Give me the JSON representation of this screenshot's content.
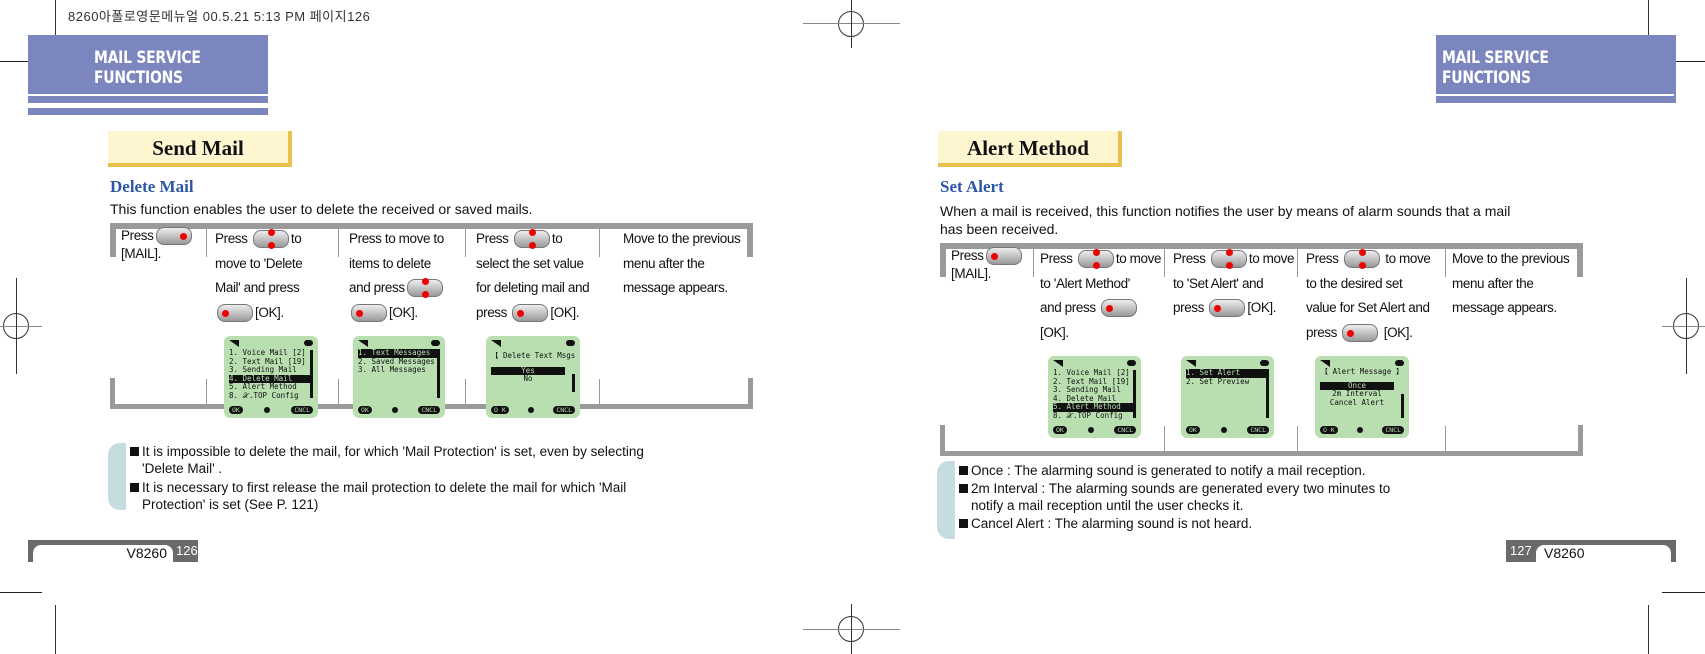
{
  "print_header": "8260아폴로영문메뉴얼   00.5.21 5:13 PM 페이지126",
  "left_page": {
    "banner": "MAIL SERVICE FUNCTIONS",
    "section_title": "Send Mail",
    "subtitle": "Delete Mail",
    "intro": "This function enables the user to delete the received or saved mails.",
    "steps": [
      {
        "pre": "Press",
        "key": "mail-key",
        "post": "[MAIL]."
      },
      {
        "pre": "Press",
        "key": "nav-key",
        "l1": "to",
        "l2": "move to  'Delete",
        "l3": "Mail'  and press",
        "l4": "[OK]."
      },
      {
        "l1": "Press to move to",
        "l2": "items to delete",
        "l3": "and press",
        "l4": "[OK]."
      },
      {
        "pre": "Press",
        "l1": "to",
        "l2": "select the set value",
        "l3": "for deleting mail and",
        "l4pre": "press",
        "l4": "[OK]."
      },
      {
        "l1": "Move to the previous",
        "l2": "menu after the",
        "l3": "message appears."
      }
    ],
    "screens": [
      {
        "rows": [
          "1. Voice Mail [2]",
          "2. Text Mail [19]",
          "3. Sending Mail",
          "4. Delete Mail",
          "5. Alert Method",
          "8. 𝒳.TOP Config"
        ],
        "selected": 3,
        "ok": "OK",
        "cancel": "CNCL"
      },
      {
        "rows": [
          "1. Text Messages",
          "2. Saved Messages",
          "3. All Messages"
        ],
        "selected": 0,
        "ok": "OK",
        "cancel": "CNCL"
      },
      {
        "title": "【 Delete Text Msgs 】",
        "rows": [
          "Yes",
          "No"
        ],
        "selected": 0,
        "ok": "O K",
        "cancel": "CNCL"
      }
    ],
    "notes": [
      {
        "l1": "It  is impossible to delete  the mail, for which  'Mail  Protection' is set, even by selecting",
        "l2": "'Delete Mail' ."
      },
      {
        "l1": "It is necessary to first release  the mail protection to delete the mail  for which 'Mail",
        "l2": "Protection'  is set (See P. 121)"
      }
    ],
    "footer_model": "V8260",
    "page_number": "126"
  },
  "right_page": {
    "banner": "MAIL SERVICE FUNCTIONS",
    "section_title": "Alert Method",
    "subtitle": "Set Alert",
    "intro_l1": "When a mail is received, this function notifies the user  by means of alarm sounds that a mail",
    "intro_l2": " has been received.",
    "steps": [
      {
        "pre": "Press",
        "post": "[MAIL]."
      },
      {
        "pre": "Press",
        "l1": "to move",
        "l2": "to  'Alert Method'",
        "l3": "and press",
        "l4": "[OK]."
      },
      {
        "pre": "Press",
        "l1": "to move",
        "l2": "to 'Set Alert' and",
        "l3pre": "press",
        "l3": "[OK]."
      },
      {
        "pre": "Press",
        "l1": "to move",
        "l2": "to the desired set",
        "l3": "value for Set Alert and",
        "l4pre": "press",
        "l4": "[OK]."
      },
      {
        "l1": "Move to the previous",
        "l2": "menu after the",
        "l3": "message appears."
      }
    ],
    "screens": [
      {
        "rows": [
          "1. Voice Mail [2]",
          "2. Text Mail [19]",
          "3. Sending Mail",
          "4. Delete Mail",
          "5. Alert Method",
          "8. 𝒳.TOP Config"
        ],
        "selected": 4,
        "ok": "OK",
        "cancel": "CNCL"
      },
      {
        "rows": [
          "1. Set Alert",
          "2. Set Preview"
        ],
        "selected": 0,
        "ok": "OK",
        "cancel": "CNCL"
      },
      {
        "title": "【 Alert Message 】",
        "rows": [
          "Once",
          "2m Interval",
          "Cancel Alert"
        ],
        "selected": 0,
        "ok": "O K",
        "cancel": "CNCL"
      }
    ],
    "notes": [
      {
        "l1": "Once : The alarming sound is generated to notify a mail reception."
      },
      {
        "l1": "2m Interval : The alarming sounds are  generated every two minutes to",
        "l2": "notify a mail reception until the user checks it."
      },
      {
        "l1": "Cancel Alert : The alarming sound is not heard."
      }
    ],
    "footer_model": "V8260",
    "page_number": "127"
  }
}
